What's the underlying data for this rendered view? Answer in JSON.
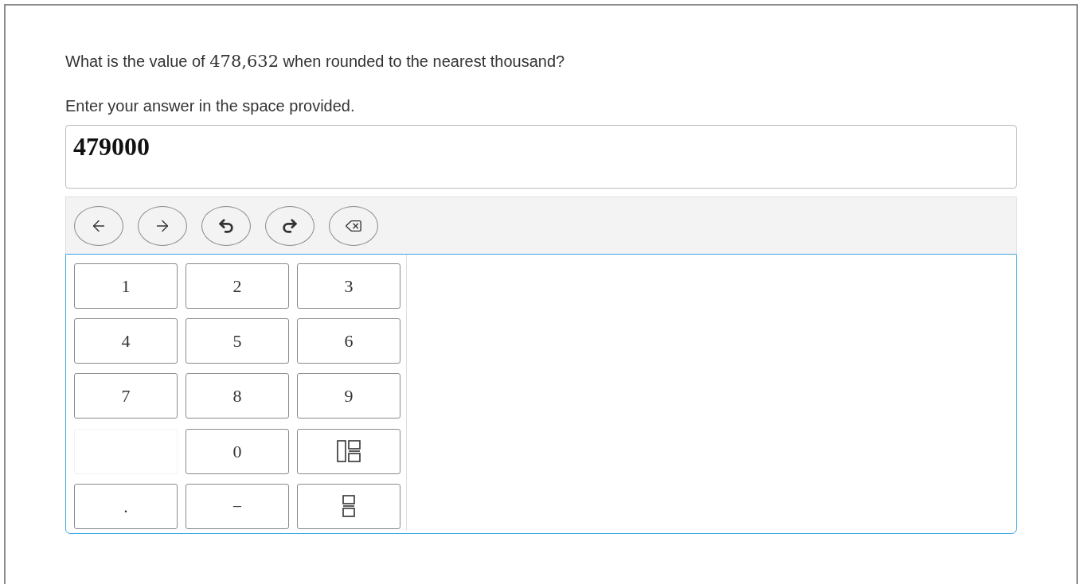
{
  "question": {
    "parts": [
      {
        "kind": "text",
        "text": "What is the value of "
      },
      {
        "kind": "math",
        "text": "478,632"
      },
      {
        "kind": "text",
        "text": " when rounded to the nearest thousand?"
      }
    ]
  },
  "instruction": "Enter your answer in the space provided.",
  "answer": {
    "value": "479000"
  },
  "keypad": [
    {
      "kind": "key",
      "label": "1"
    },
    {
      "kind": "key",
      "label": "2"
    },
    {
      "kind": "key",
      "label": "3"
    },
    {
      "kind": "key",
      "label": "4"
    },
    {
      "kind": "key",
      "label": "5"
    },
    {
      "kind": "key",
      "label": "6"
    },
    {
      "kind": "key",
      "label": "7"
    },
    {
      "kind": "key",
      "label": "8"
    },
    {
      "kind": "key",
      "label": "9"
    },
    {
      "kind": "blank"
    },
    {
      "kind": "key",
      "label": "0"
    },
    {
      "kind": "mixed-fraction"
    },
    {
      "kind": "key",
      "label": "."
    },
    {
      "kind": "key",
      "label": "−"
    },
    {
      "kind": "fraction"
    }
  ]
}
